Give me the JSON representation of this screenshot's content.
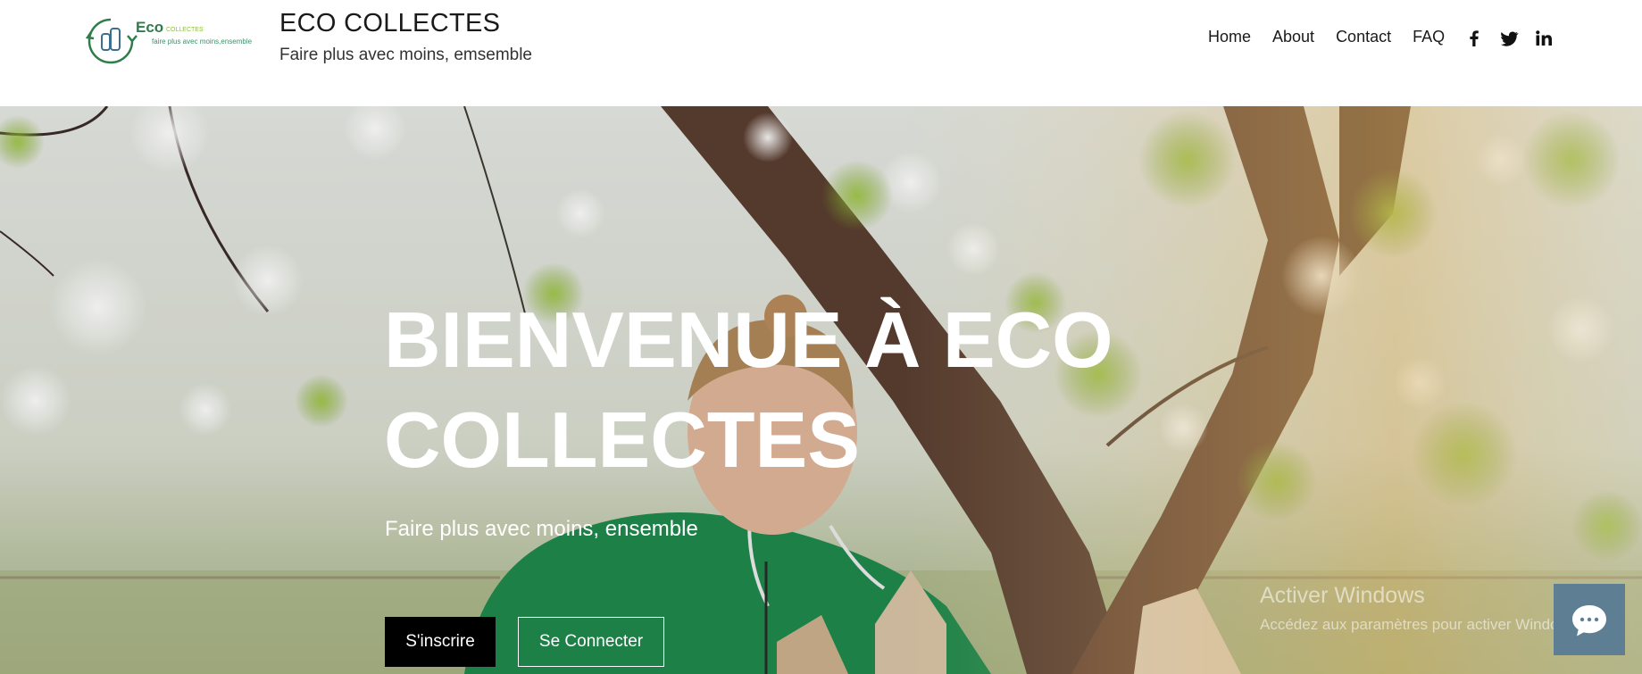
{
  "header": {
    "logo": {
      "word": "Eco",
      "small_word": "COLLECTES",
      "small_tagline": "faire plus avec moins,ensemble"
    },
    "title": "ECO COLLECTES",
    "tagline": "Faire plus avec moins, emsemble",
    "nav": [
      "Home",
      "About",
      "Contact",
      "FAQ"
    ],
    "social_icons": [
      "facebook-icon",
      "twitter-icon",
      "linkedin-icon"
    ]
  },
  "hero": {
    "title": "BIENVENUE À ECO COLLECTES",
    "subtitle": "Faire plus avec moins, ensemble",
    "signup_label": "S'inscrire",
    "login_label": "Se Connecter"
  },
  "watermark": {
    "title": "Activer Windows",
    "subtitle": "Accédez aux paramètres pour activer Windows."
  },
  "chat": {
    "icon": "chat-icon"
  },
  "colors": {
    "logo_green": "#2e7d4a",
    "chat_bg": "#5e7f93",
    "button_dark": "#000000",
    "leaf_green": "#8fbf3a",
    "hoodie_green": "#1f8a4c"
  }
}
